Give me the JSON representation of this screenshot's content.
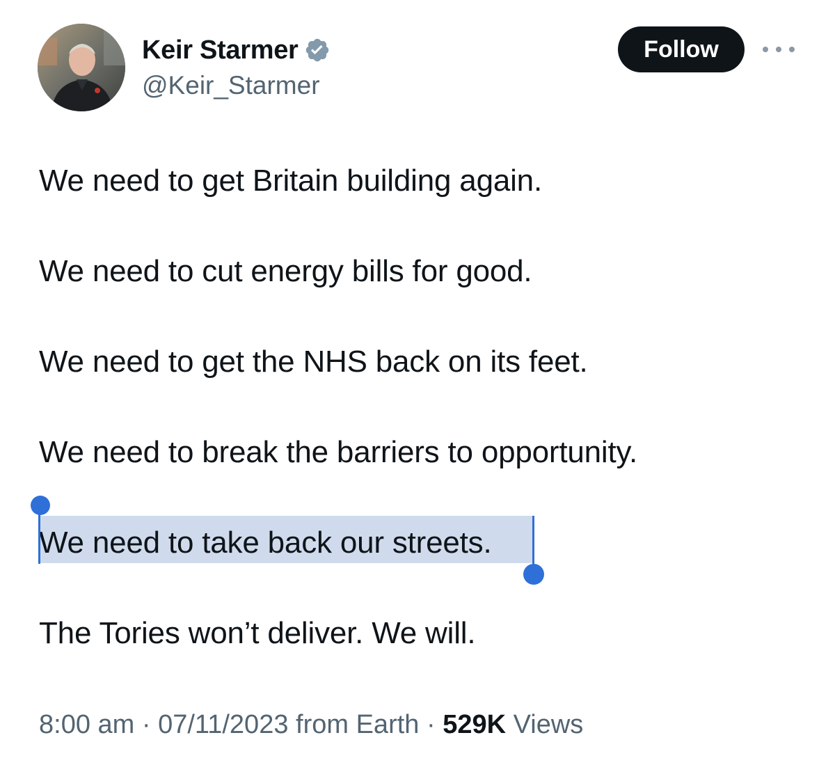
{
  "author": {
    "display_name": "Keir Starmer",
    "handle": "@Keir_Starmer",
    "verified": true,
    "avatar": "profile-photo"
  },
  "actions": {
    "follow_label": "Follow",
    "more_icon": "more-horizontal-icon"
  },
  "tweet": {
    "lines": [
      "We need to get Britain building again.",
      "We need to cut energy bills for good.",
      "We need to get the NHS back on its feet.",
      "We need to break the barriers to opportunity.",
      "We need to take back our streets.",
      "The Tories won’t deliver. We will."
    ],
    "selected_line_index": 4
  },
  "meta": {
    "time": "8:00 am",
    "separator": "·",
    "date": "07/11/2023",
    "source": "from Earth",
    "views_count": "529K",
    "views_label": "Views"
  },
  "colors": {
    "text": "#0f1419",
    "secondary": "#536471",
    "verified_badge": "#829aab",
    "selection": "#cfdbed",
    "selection_handle": "#2f6fd8",
    "follow_bg": "#0f1419"
  }
}
